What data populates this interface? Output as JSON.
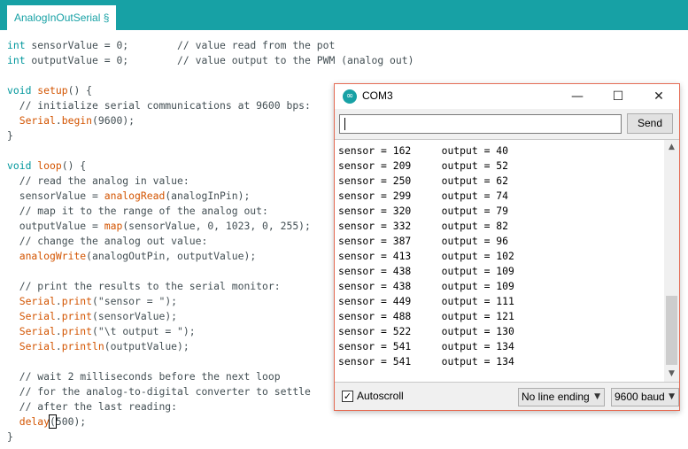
{
  "tab": {
    "label": "AnalogInOutSerial §"
  },
  "code_lines": [
    {
      "y": 52,
      "parts": [
        [
          "kw",
          "int"
        ],
        [
          "",
          " sensorValue = 0;        "
        ],
        [
          "cm",
          "// value read from the pot"
        ]
      ]
    }
  ],
  "code": {
    "l1a": "int",
    "l1b": " sensorValue = 0;        // value read from the pot",
    "l2a": "int",
    "l2b": " outputValue = 0;        // value output to the PWM (analog out)",
    "l3a": "void",
    "l3b": " ",
    "l3c": "setup",
    "l3d": "() {",
    "l4": "  // initialize serial communications at 9600 bps:",
    "l5a": "  ",
    "l5b": "Serial",
    "l5c": ".",
    "l5d": "begin",
    "l5e": "(9600);",
    "l6": "}",
    "l7a": "void",
    "l7b": " ",
    "l7c": "loop",
    "l7d": "() {",
    "l8": "  // read the analog in value:",
    "l9a": "  sensorValue = ",
    "l9b": "analogRead",
    "l9c": "(analogInPin);",
    "l10": "  // map it to the range of the analog out:",
    "l11a": "  outputValue = ",
    "l11b": "map",
    "l11c": "(sensorValue, 0, 1023, 0, 255);",
    "l12": "  // change the analog out value:",
    "l13a": "  ",
    "l13b": "analogWrite",
    "l13c": "(analogOutPin, outputValue);",
    "l14": "  // print the results to the serial monitor:",
    "l15a": "  ",
    "l15b": "Serial",
    "l15c": ".",
    "l15d": "print",
    "l15e": "(\"sensor = \");",
    "l16a": "  ",
    "l16b": "Serial",
    "l16c": ".",
    "l16d": "print",
    "l16e": "(sensorValue);",
    "l17a": "  ",
    "l17b": "Serial",
    "l17c": ".",
    "l17d": "print",
    "l17e": "(\"\\t output = \");",
    "l18a": "  ",
    "l18b": "Serial",
    "l18c": ".",
    "l18d": "println",
    "l18e": "(outputValue);",
    "l19": "  // wait 2 milliseconds before the next loop",
    "l20": "  // for the analog-to-digital converter to settle",
    "l21": "  // after the last reading:",
    "l22a": "  ",
    "l22b": "delay",
    "l22c": "(",
    "l22d": "500);",
    "l23": "}"
  },
  "monitor": {
    "title": "COM3",
    "icon": "arduino-logo-icon",
    "minimize": "—",
    "maximize": "☐",
    "close": "✕",
    "input_value": "",
    "send_label": "Send",
    "output": [
      "sensor = 162     output = 40",
      "sensor = 209     output = 52",
      "sensor = 250     output = 62",
      "sensor = 299     output = 74",
      "sensor = 320     output = 79",
      "sensor = 332     output = 82",
      "sensor = 387     output = 96",
      "sensor = 413     output = 102",
      "sensor = 438     output = 109",
      "sensor = 438     output = 109",
      "sensor = 449     output = 111",
      "sensor = 488     output = 121",
      "sensor = 522     output = 130",
      "sensor = 541     output = 134",
      "sensor = 541     output = 134"
    ],
    "autoscroll_label": "Autoscroll",
    "autoscroll_checked": true,
    "line_ending": "No line ending",
    "baud": "9600 baud"
  },
  "colors": {
    "accent": "#17a1a5",
    "keyword": "#00979c",
    "function": "#d35400",
    "window_border": "#e56c55"
  }
}
